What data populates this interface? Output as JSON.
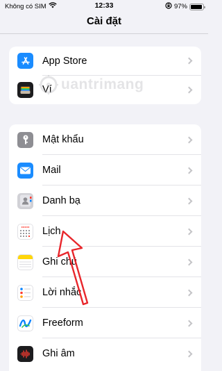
{
  "status_bar": {
    "carrier": "Không có SIM",
    "time": "12:33",
    "battery": "97%",
    "battery_level": 0.97
  },
  "header": {
    "title": "Cài đặt"
  },
  "group1": {
    "items": [
      {
        "label": "App Store",
        "icon": "app-store-icon",
        "color": "#1a8cff"
      },
      {
        "label": "Ví",
        "icon": "wallet-icon",
        "color": "#1c1c1e"
      }
    ]
  },
  "group2": {
    "items": [
      {
        "label": "Mật khẩu",
        "icon": "key-icon",
        "color": "#8e8e93"
      },
      {
        "label": "Mail",
        "icon": "mail-icon",
        "color": "#1a8cff"
      },
      {
        "label": "Danh bạ",
        "icon": "contacts-icon",
        "color": "#c7c7cc"
      },
      {
        "label": "Lịch",
        "icon": "calendar-icon",
        "color": "#ffffff"
      },
      {
        "label": "Ghi chú",
        "icon": "notes-icon",
        "color": "#ffd60a"
      },
      {
        "label": "Lời nhắc",
        "icon": "reminders-icon",
        "color": "#ffffff"
      },
      {
        "label": "Freeform",
        "icon": "freeform-icon",
        "color": "#ffffff"
      },
      {
        "label": "Ghi âm",
        "icon": "voice-memos-icon",
        "color": "#1c1c1e"
      }
    ]
  },
  "watermark": {
    "text": "uantrimang"
  },
  "annotation": {
    "color": "#e8262b",
    "icon": "red-arrow-icon"
  }
}
